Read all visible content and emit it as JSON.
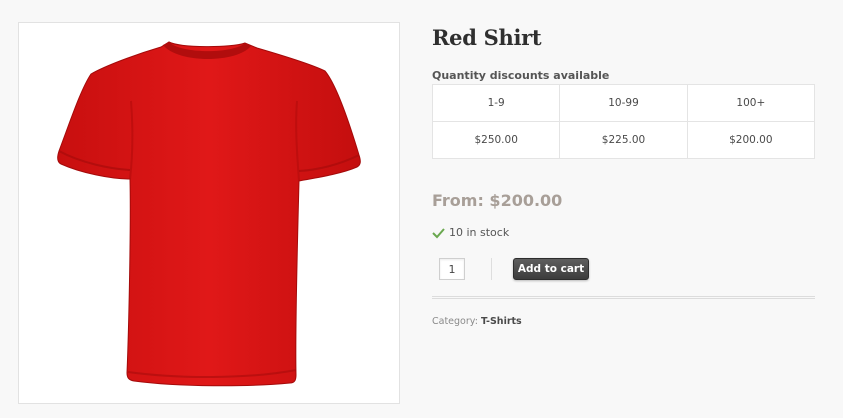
{
  "product": {
    "title": "Red Shirt",
    "image_alt": "red t-shirt product image",
    "shirt_color": "#e01515"
  },
  "discounts": {
    "heading": "Quantity discounts available",
    "tiers": [
      {
        "range": "1-9",
        "price": "$250.00"
      },
      {
        "range": "10-99",
        "price": "$225.00"
      },
      {
        "range": "100+",
        "price": "$200.00"
      }
    ]
  },
  "price": {
    "label": "From: $200.00"
  },
  "stock": {
    "text": "10 in stock",
    "icon": "check-icon",
    "icon_color": "#6aa84f"
  },
  "cart": {
    "quantity": "1",
    "button_label": "Add to cart"
  },
  "meta": {
    "category_label": "Category:",
    "category_value": "T-Shirts"
  }
}
